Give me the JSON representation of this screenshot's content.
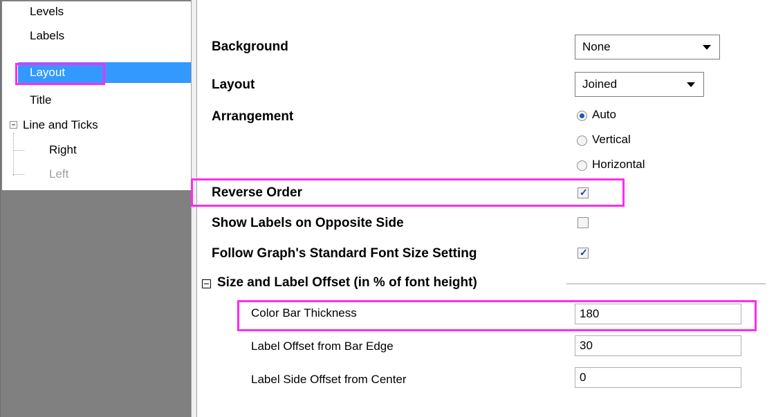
{
  "tree": {
    "items": [
      {
        "label": "Levels",
        "state": "normal"
      },
      {
        "label": "Labels",
        "state": "normal"
      },
      {
        "label": "Layout",
        "state": "selected"
      },
      {
        "label": "Title",
        "state": "normal"
      },
      {
        "label": "Line and Ticks",
        "state": "expanded"
      },
      {
        "label": "Right",
        "state": "normal"
      },
      {
        "label": "Left",
        "state": "disabled"
      }
    ]
  },
  "form": {
    "background": {
      "label": "Background",
      "value": "None"
    },
    "layout": {
      "label": "Layout",
      "value": "Joined"
    },
    "arrangement": {
      "label": "Arrangement",
      "options": [
        "Auto",
        "Vertical",
        "Horizontal"
      ],
      "selected": "Auto"
    },
    "reverse_order": {
      "label": "Reverse Order",
      "checked": true
    },
    "show_labels_opposite": {
      "label": "Show Labels on Opposite Side",
      "checked": false
    },
    "follow_font_size": {
      "label": "Follow Graph's Standard Font Size Setting",
      "checked": true
    },
    "section": {
      "label": "Size and Label Offset (in % of font height)",
      "fields": [
        {
          "label": "Color Bar Thickness",
          "value": "180"
        },
        {
          "label": "Label Offset from Bar Edge",
          "value": "30"
        },
        {
          "label": "Label Side Offset from Center",
          "value": "0"
        }
      ]
    }
  },
  "colors": {
    "highlight": "#ff2bf0",
    "selection": "#3399ff",
    "panel_gray": "#808080"
  },
  "icons": {
    "check": "✓",
    "collapse": "minus-box-icon",
    "dropdown": "triangle-down-icon"
  }
}
